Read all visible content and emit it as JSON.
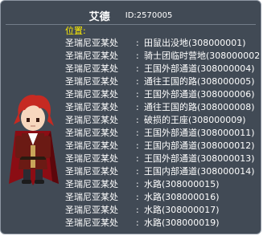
{
  "tooltip": {
    "name": "艾德",
    "id_text": "ID:2570005",
    "location_label": "位置:",
    "colors": {
      "background": "#414a55",
      "label": "#ffee00",
      "text": "#ffffff"
    },
    "locations": [
      {
        "region": "圣瑞尼亚某处",
        "sep": ":",
        "place": "田鼠出没地(308000001)"
      },
      {
        "region": "圣瑞尼亚某处",
        "sep": ":",
        "place": "骑士团临时营地(308000002)"
      },
      {
        "region": "圣瑞尼亚某处",
        "sep": ":",
        "place": "王国外部通道(308000004)"
      },
      {
        "region": "圣瑞尼亚某处",
        "sep": ":",
        "place": "通往王国的路(308000005)"
      },
      {
        "region": "圣瑞尼亚某处",
        "sep": ":",
        "place": "王国外部通道(308000006)"
      },
      {
        "region": "圣瑞尼亚某处",
        "sep": ":",
        "place": "通往王国的路(308000008)"
      },
      {
        "region": "圣瑞尼亚某处",
        "sep": ":",
        "place": "破损的王座(308000009)"
      },
      {
        "region": "圣瑞尼亚某处",
        "sep": ":",
        "place": "王国外部通道(308000011)"
      },
      {
        "region": "圣瑞尼亚某处",
        "sep": ":",
        "place": "王国内部通道(308000012)"
      },
      {
        "region": "圣瑞尼亚某处",
        "sep": ":",
        "place": "王国外部通道(308000013)"
      },
      {
        "region": "圣瑞尼亚某处",
        "sep": ":",
        "place": "王国内部通道(308000014)"
      },
      {
        "region": "圣瑞尼亚某处",
        "sep": ":",
        "place": "水路(308000015)"
      },
      {
        "region": "圣瑞尼亚某处",
        "sep": ":",
        "place": "水路(308000016)"
      },
      {
        "region": "圣瑞尼亚某处",
        "sep": ":",
        "place": "水路(308000017)"
      },
      {
        "region": "圣瑞尼亚某处",
        "sep": ":",
        "place": "水路(308000019)"
      }
    ]
  }
}
